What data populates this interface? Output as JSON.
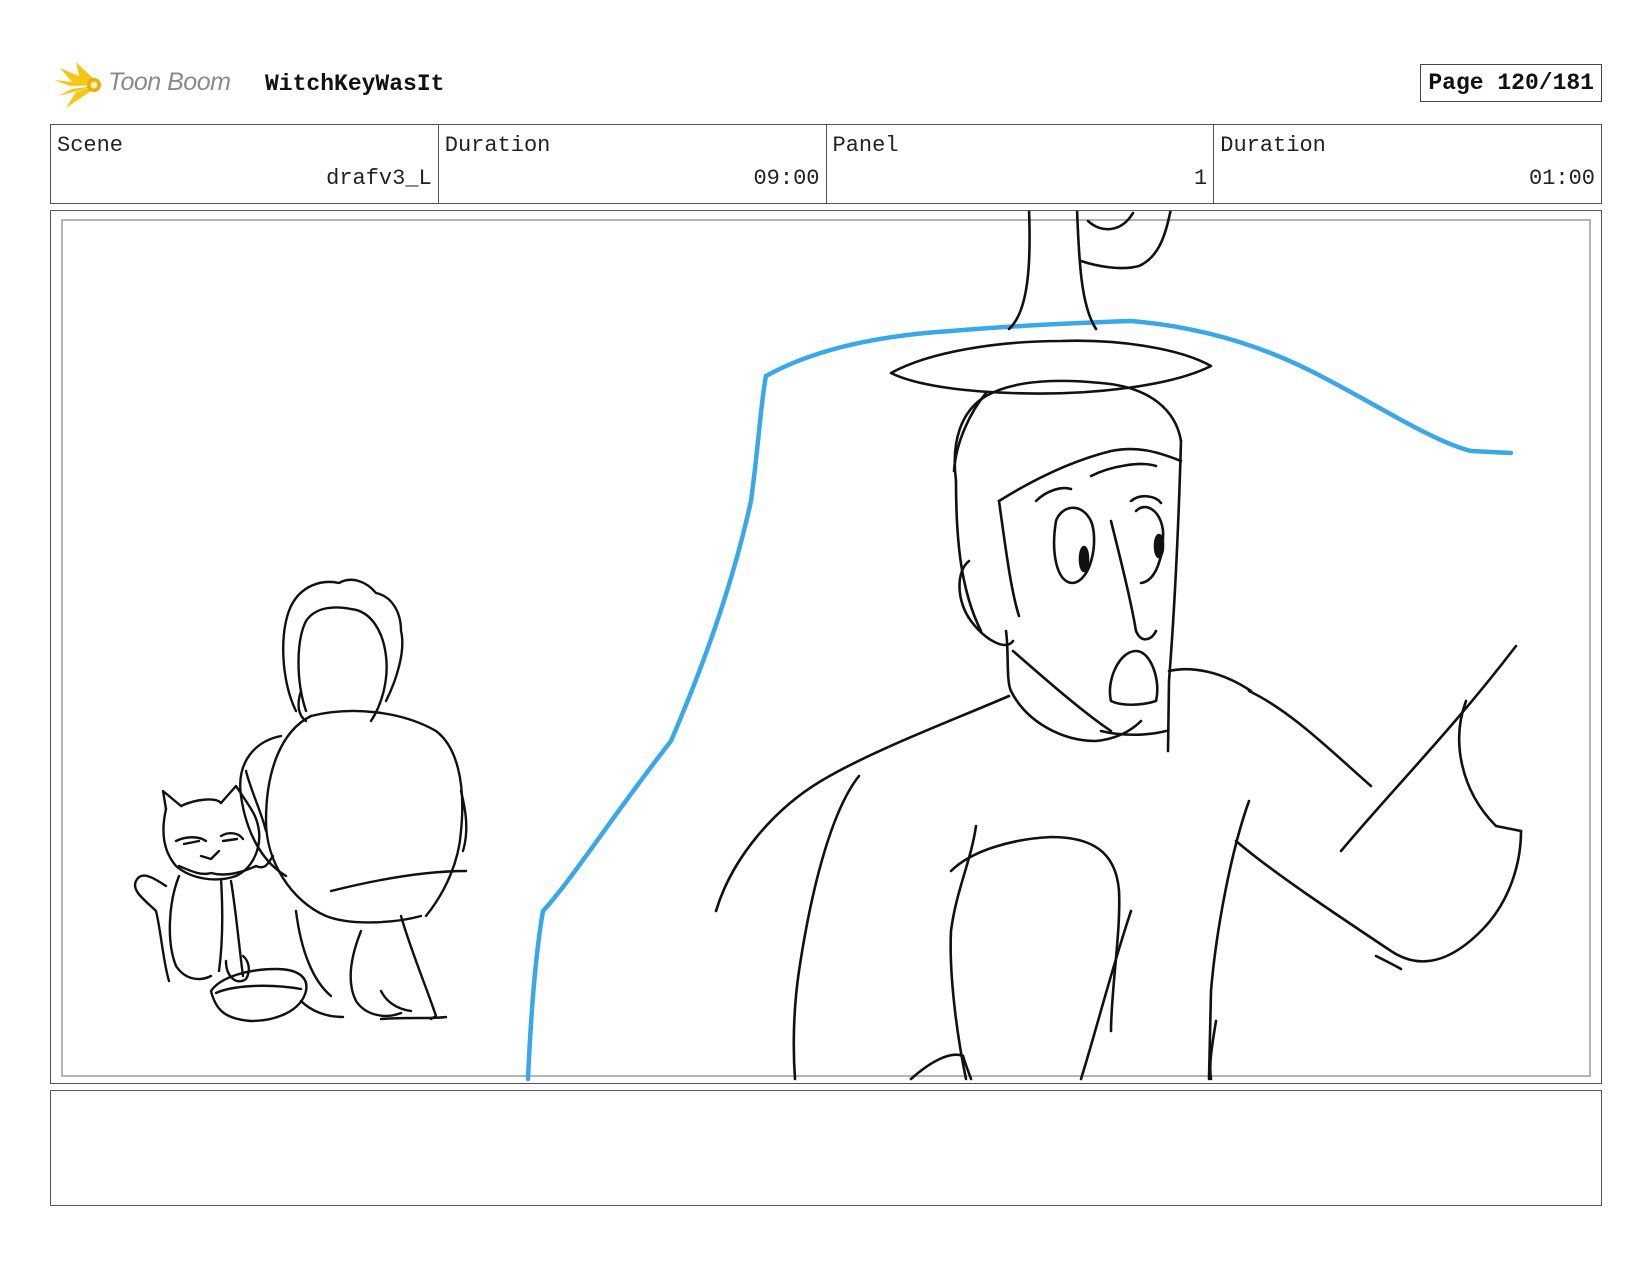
{
  "header": {
    "brand": "Toon Boom",
    "project_title": "WitchKeyWasIt",
    "page_label": "Page 120/181"
  },
  "info": {
    "scene_label": "Scene",
    "scene_value": "drafv3_L",
    "scene_duration_label": "Duration",
    "scene_duration_value": "09:00",
    "panel_label": "Panel",
    "panel_value": "1",
    "panel_duration_label": "Duration",
    "panel_duration_value": "01:00"
  },
  "notes": {
    "text": ""
  },
  "colors": {
    "sketch_line": "#111111",
    "blue_line": "#3aa8e8",
    "logo_yellow": "#f5c518",
    "logo_text": "#8a8a8a"
  }
}
